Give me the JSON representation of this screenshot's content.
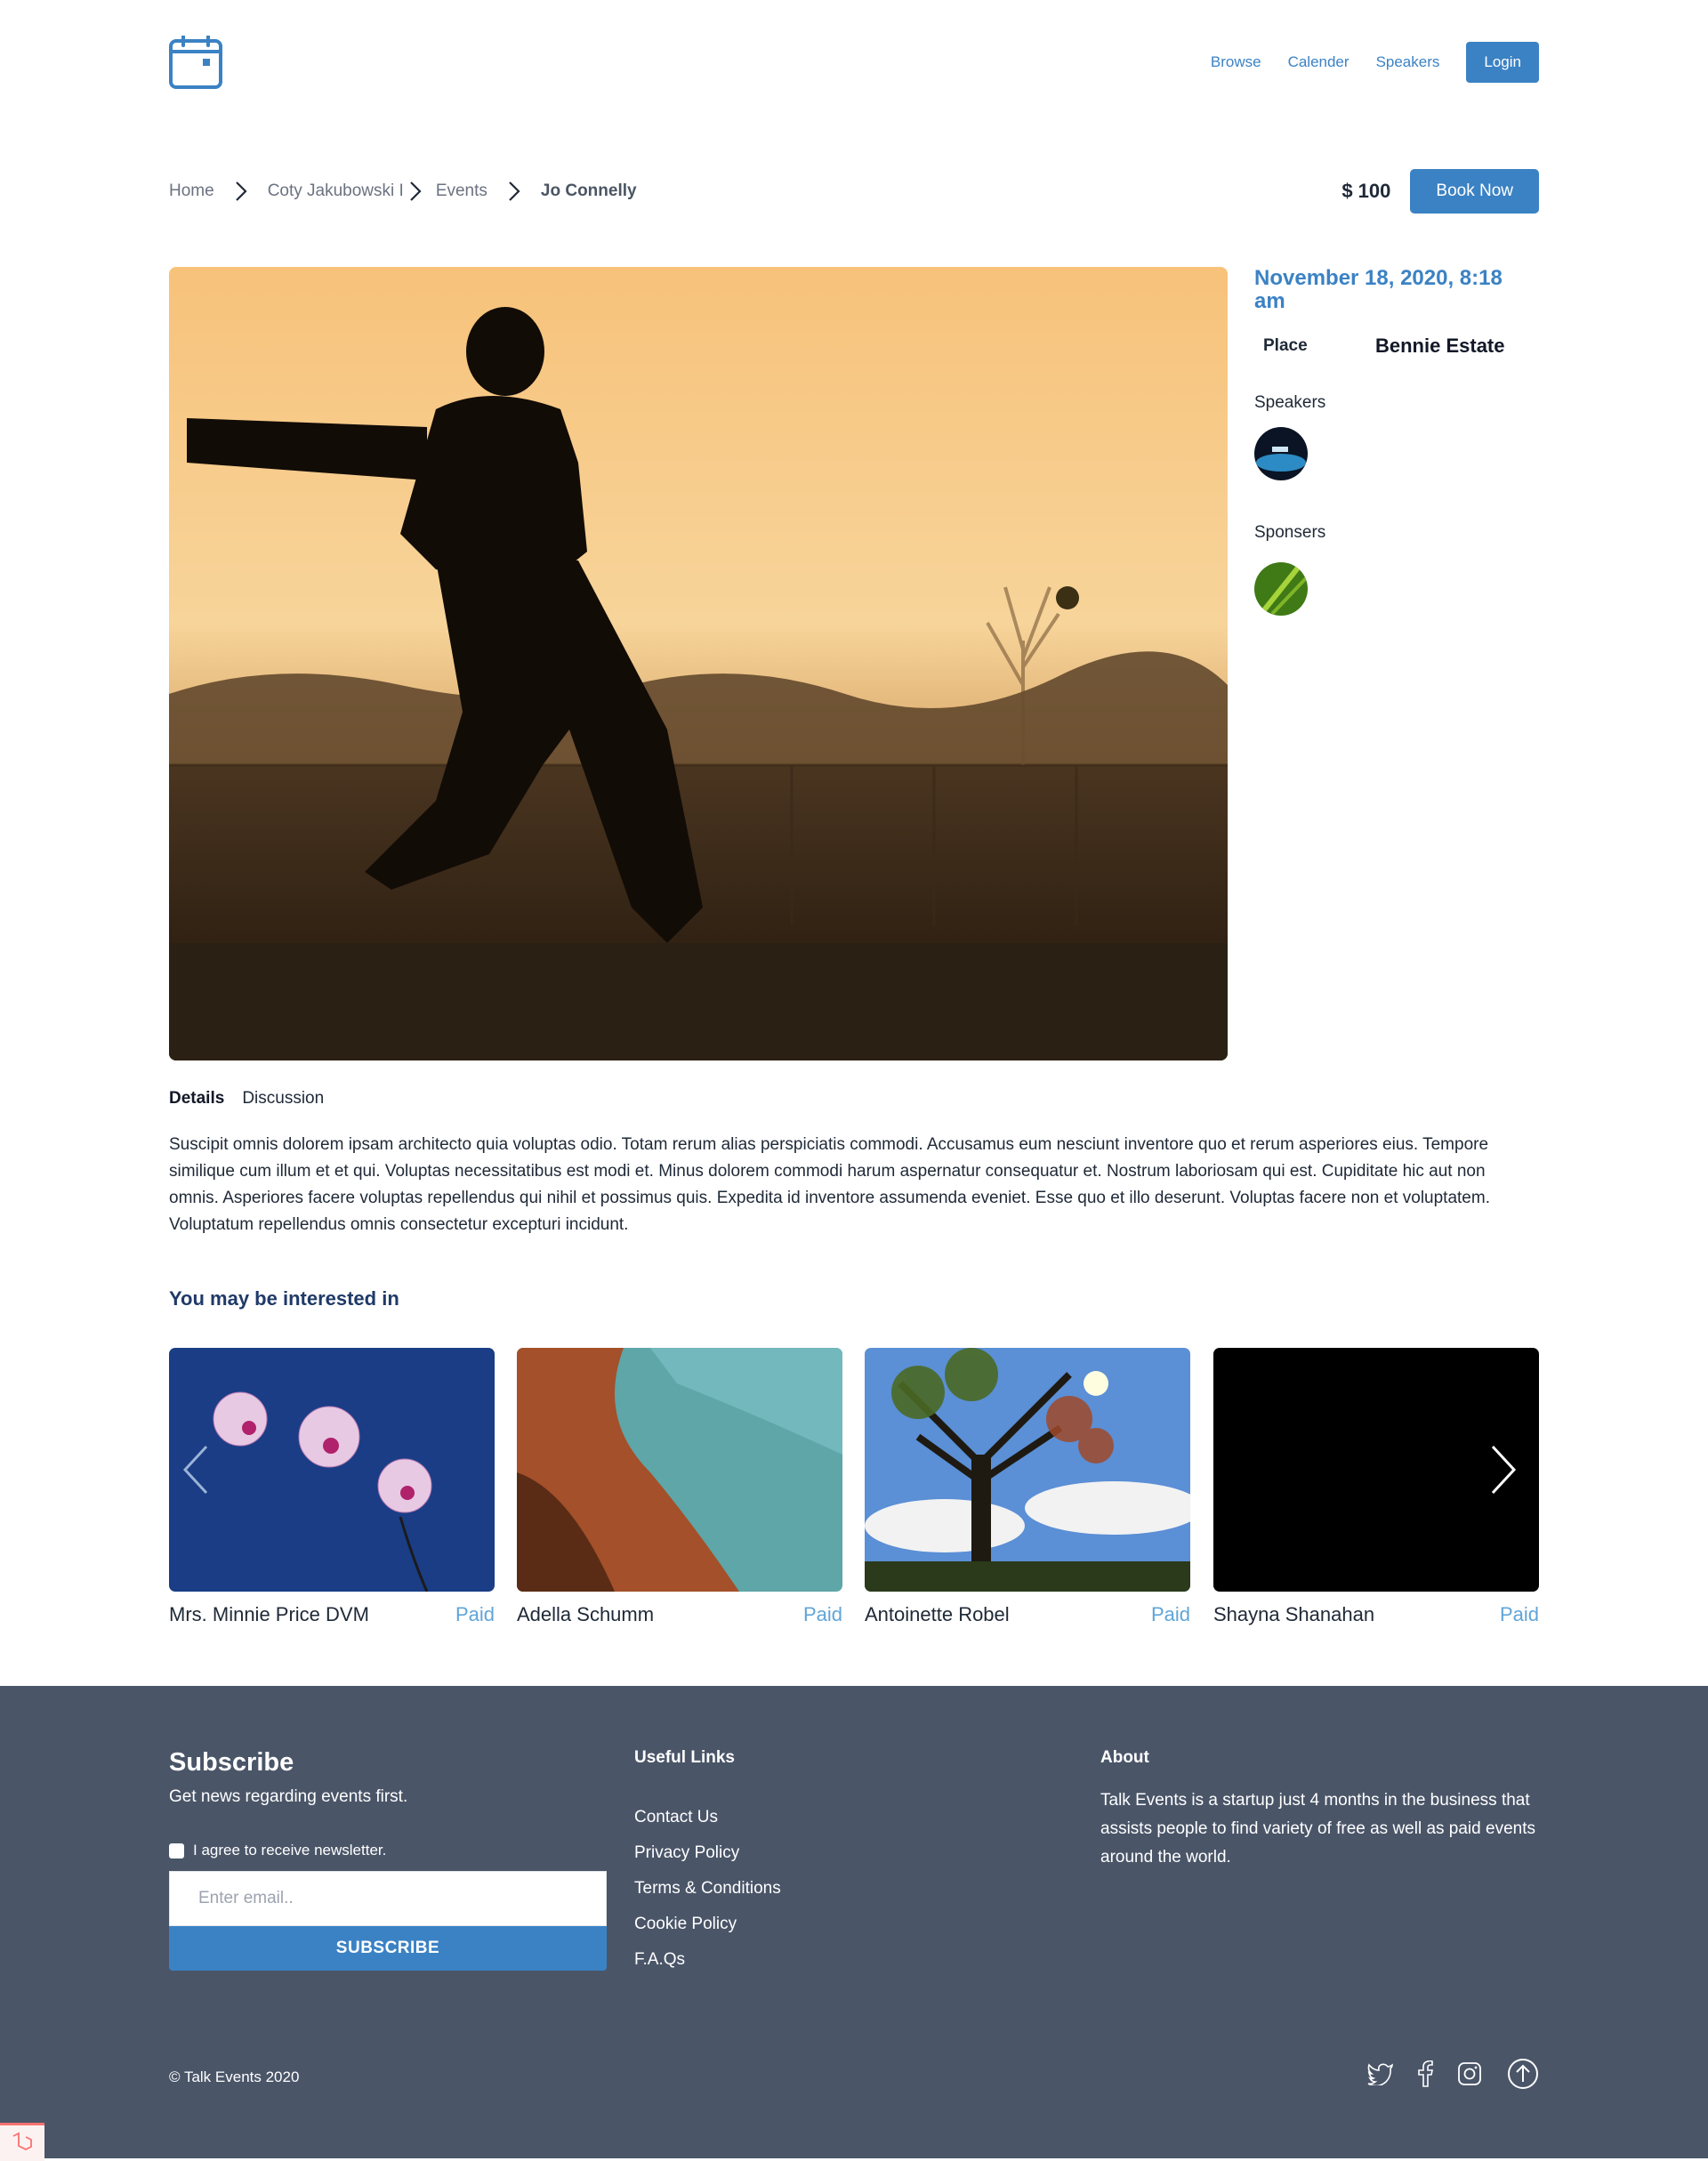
{
  "header": {
    "nav": [
      "Browse",
      "Calender",
      "Speakers"
    ],
    "login_label": "Login",
    "logo_icon": "calendar-icon"
  },
  "breadcrumb": [
    "Home",
    "Coty Jakubowski I",
    "Events",
    "Jo Connelly"
  ],
  "event": {
    "price": "$ 100",
    "book_label": "Book Now",
    "date": "November 18, 2020, 8:18 am",
    "place_label": "Place",
    "place_value": "Bennie Estate",
    "speakers_label": "Speakers",
    "sponsors_label": "Sponsers",
    "tabs": [
      "Details",
      "Discussion"
    ],
    "description": "Suscipit omnis dolorem ipsam architecto quia voluptas odio. Totam rerum alias perspiciatis commodi. Accusamus eum nesciunt inventore quo et rerum asperiores eius. Tempore similique cum illum et et qui. Voluptas necessitatibus est modi et. Minus dolorem commodi harum aspernatur consequatur et. Nostrum laboriosam qui est. Cupiditate hic aut non omnis. Asperiores facere voluptas repellendus qui nihil et possimus quis. Expedita id inventore assumenda eveniet. Esse quo et illo deserunt. Voluptas facere non et voluptatem. Voluptatum repellendus omnis consectetur excepturi incidunt."
  },
  "interested": {
    "title": "You may be interested in",
    "cards": [
      {
        "name": "Mrs. Minnie Price DVM",
        "tag": "Paid"
      },
      {
        "name": "Adella Schumm",
        "tag": "Paid"
      },
      {
        "name": "Antoinette Robel",
        "tag": "Paid"
      },
      {
        "name": "Shayna Shanahan",
        "tag": "Paid"
      }
    ]
  },
  "footer": {
    "subscribe_title": "Subscribe",
    "subscribe_text": "Get news regarding events first.",
    "agree_label": "I agree to receive newsletter.",
    "email_placeholder": "Enter email..",
    "subscribe_button": "SUBSCRIBE",
    "links_title": "Useful Links",
    "links": [
      "Contact Us",
      "Privacy Policy",
      "Terms & Conditions",
      "Cookie Policy",
      "F.A.Qs"
    ],
    "about_title": "About",
    "about_text": "Talk Events is a startup just 4 months in the business that assists people to find variety of free as well as paid events around the world.",
    "copyright": "© Talk Events 2020",
    "social_icons": [
      "twitter-icon",
      "facebook-icon",
      "instagram-icon",
      "arrow-up-circle-icon"
    ]
  },
  "colors": {
    "accent": "#3b82c4",
    "footer_bg": "#4a5568",
    "tag": "#60a5d8",
    "heading": "#1f3a68"
  }
}
